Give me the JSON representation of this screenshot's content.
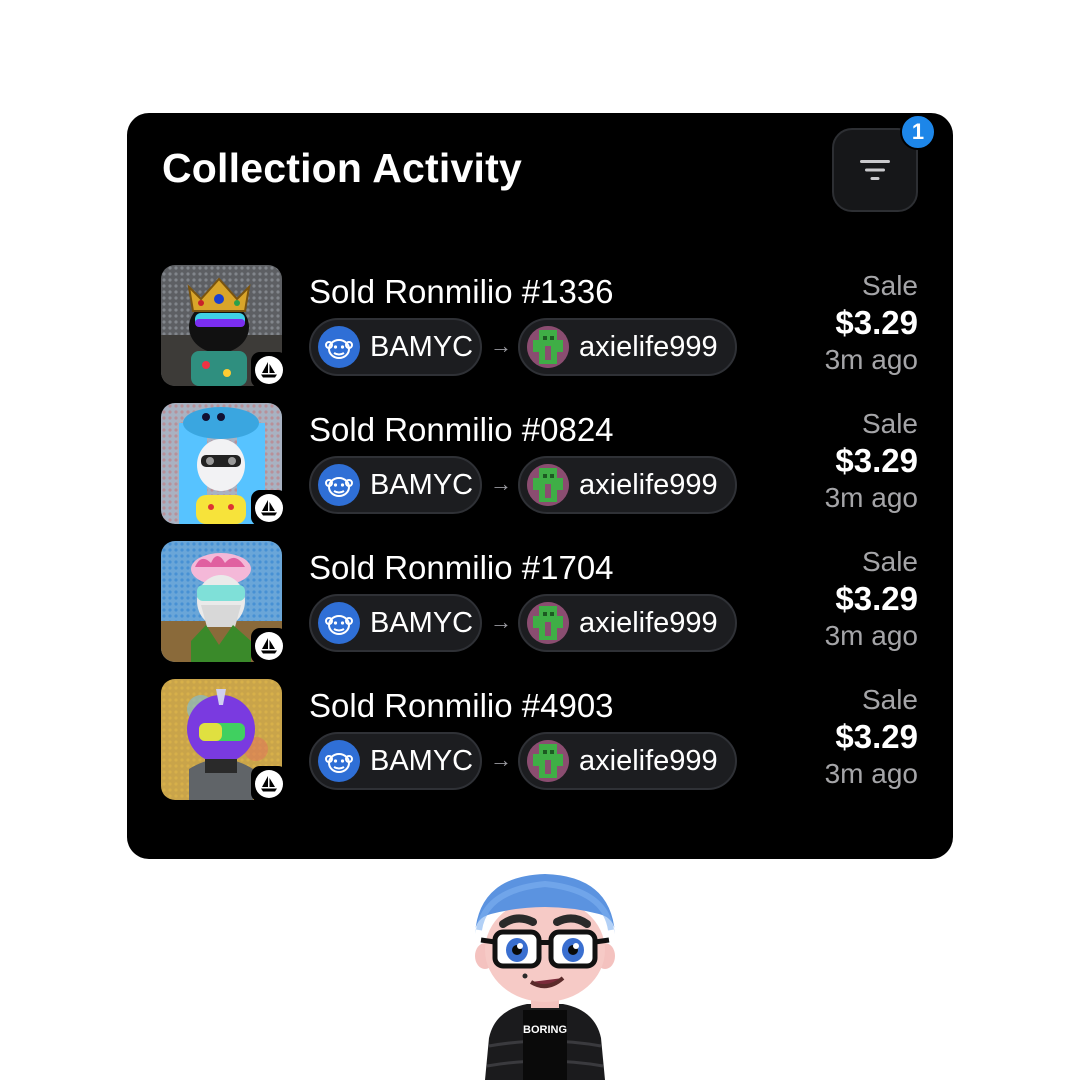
{
  "card": {
    "title": "Collection Activity",
    "filter": {
      "icon": "filter-icon",
      "badge_count": "1"
    }
  },
  "activities": [
    {
      "title": "Sold Ronmilio #1336",
      "from": "BAMYC",
      "to": "axielife999",
      "type": "Sale",
      "price": "$3.29",
      "time": "3m ago"
    },
    {
      "title": "Sold Ronmilio #0824",
      "from": "BAMYC",
      "to": "axielife999",
      "type": "Sale",
      "price": "$3.29",
      "time": "3m ago"
    },
    {
      "title": "Sold Ronmilio #1704",
      "from": "BAMYC",
      "to": "axielife999",
      "type": "Sale",
      "price": "$3.29",
      "time": "3m ago"
    },
    {
      "title": "Sold Ronmilio #4903",
      "from": "BAMYC",
      "to": "axielife999",
      "type": "Sale",
      "price": "$3.29",
      "time": "3m ago"
    }
  ],
  "mascot": {
    "shirt_text": "BORING"
  },
  "colors": {
    "card_bg": "#000000",
    "page_bg": "#ffffff",
    "badge_blue": "#1d86e8",
    "muted_text": "#a5a5a8",
    "chip_bg": "#1c1d20"
  }
}
